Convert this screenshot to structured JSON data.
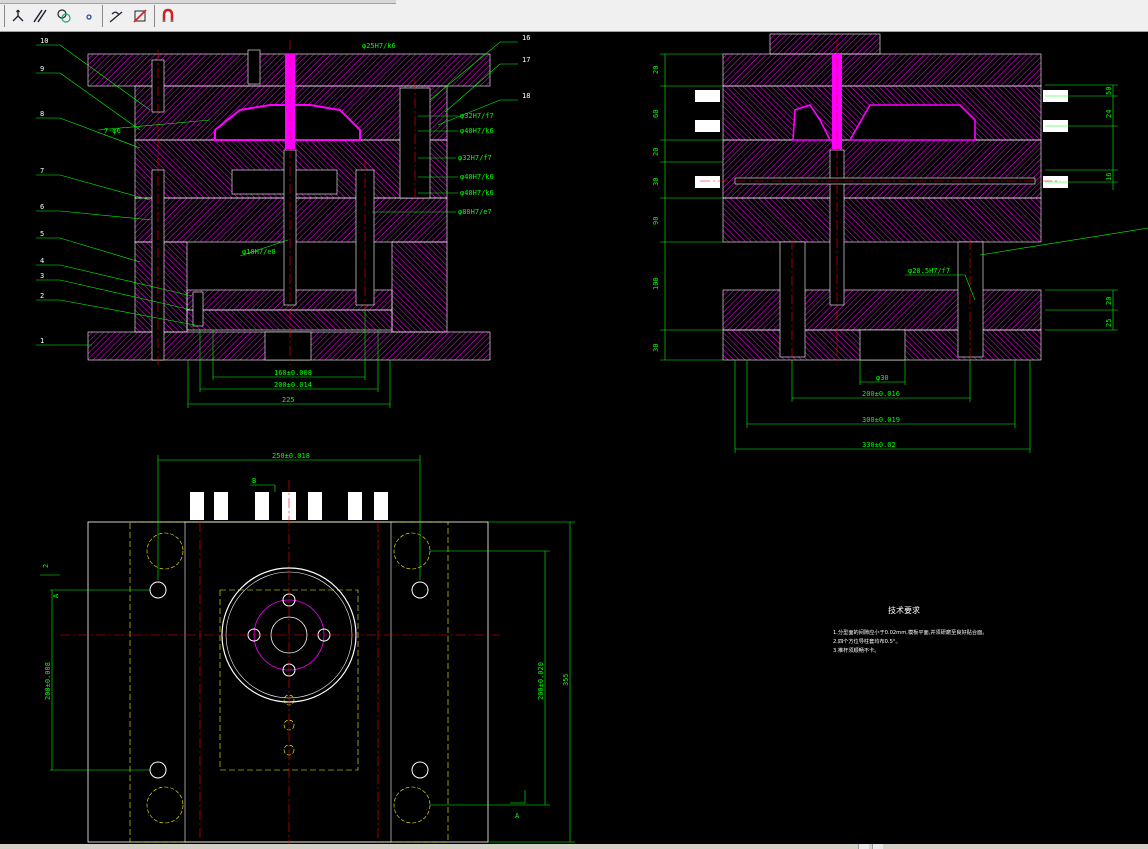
{
  "toolbar": {
    "buttons": [
      {
        "name": "ucs-icon"
      },
      {
        "name": "parallel-lines-icon"
      },
      {
        "name": "circles-icon"
      },
      {
        "name": "point-icon"
      },
      {
        "name": "tangent-icon"
      },
      {
        "name": "no-snap-icon"
      },
      {
        "name": "magnet-snap-icon"
      }
    ]
  },
  "colors": {
    "background": "#000000",
    "dimension": "#00ff00",
    "hatch": "#ff00ff",
    "outline": "#ffffff",
    "centerline": "#ff0000",
    "hidden": "#ffff00"
  },
  "front_view": {
    "balloons": [
      "10",
      "9",
      "8",
      "7",
      "6",
      "5",
      "4",
      "3",
      "2",
      "1",
      "16",
      "17",
      "18"
    ],
    "leader_labels": [
      "7-φ6"
    ],
    "fits": [
      "φ25H7/k6",
      "φ32H7/f7",
      "φ40H7/k6",
      "φ32H7/f7",
      "φ40H7/k6",
      "φ40H7/k6",
      "φ80H7/e7",
      "φ10H7/e8"
    ],
    "dims": [
      "160±0.008",
      "200±0.014",
      "225"
    ]
  },
  "side_view": {
    "left_dims": [
      "20",
      "60",
      "20",
      "30",
      "90",
      "100",
      "30"
    ],
    "right_dims": [
      "50",
      "24",
      "16",
      "20",
      "25"
    ],
    "fits": [
      "φ20.5H7/f7"
    ],
    "bottom_dims": [
      "φ30",
      "200±0.016",
      "300±0.019",
      "330±0.02"
    ]
  },
  "top_view": {
    "top_dim": "250±0.018",
    "section_mark": "B",
    "left_marks": [
      "2",
      "A"
    ],
    "left_dim": "200±0.008",
    "right_dims": [
      "200±0.020",
      "355"
    ],
    "bottom_mark": "A"
  },
  "notes": {
    "title": "技术要求",
    "lines": [
      "1.分型面的间隙应小于0.02mm,模板平面,并须研磨至良好贴合面。",
      "2.四个方位导柱套均布0.5°。",
      "3.推杆须顺畅不卡。"
    ]
  }
}
